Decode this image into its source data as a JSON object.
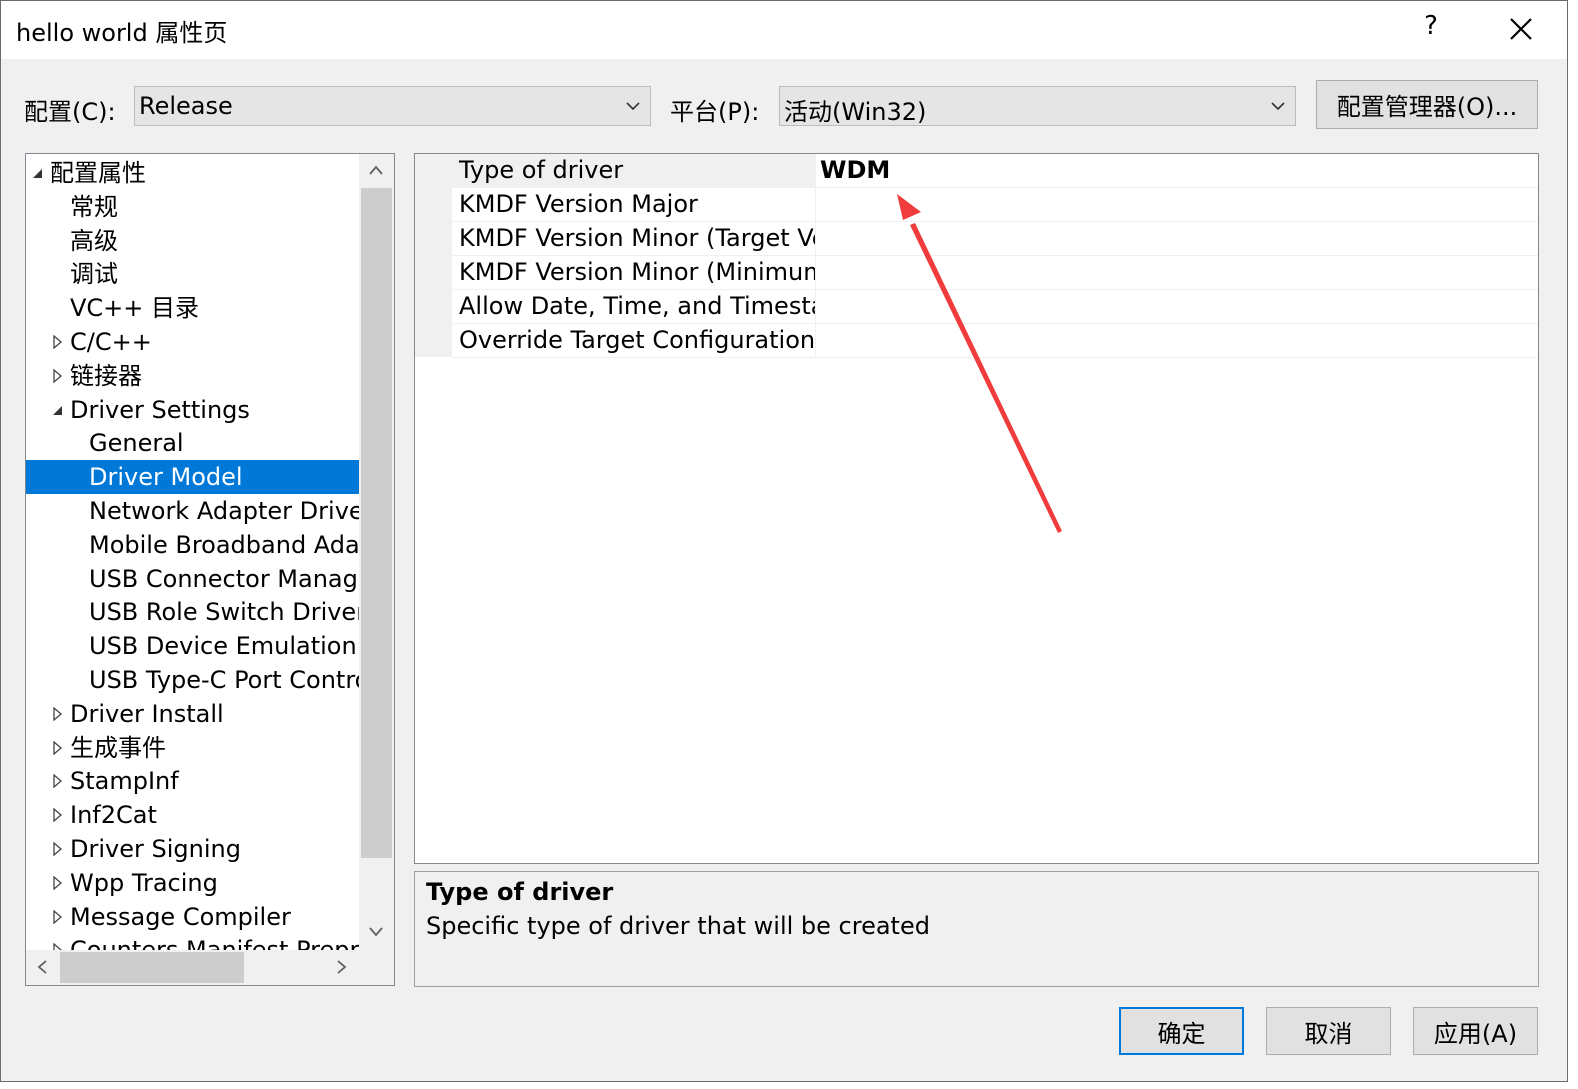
{
  "window": {
    "title": "hello world 属性页",
    "help_label": "?",
    "close_icon": "close-icon"
  },
  "config_bar": {
    "config_label": "配置(C):",
    "config_value": "Release",
    "platform_label": "平台(P):",
    "platform_value": "活动(Win32)",
    "manager_button": "配置管理器(O)..."
  },
  "tree": {
    "items": [
      {
        "label": "配置属性",
        "arrow": "expanded"
      },
      {
        "label": "常规",
        "arrow": "none"
      },
      {
        "label": "高级",
        "arrow": "none"
      },
      {
        "label": "调试",
        "arrow": "none"
      },
      {
        "label": "VC++ 目录",
        "arrow": "none"
      },
      {
        "label": "C/C++",
        "arrow": "collapsed"
      },
      {
        "label": "链接器",
        "arrow": "collapsed"
      },
      {
        "label": "Driver Settings",
        "arrow": "expanded"
      },
      {
        "label": "General",
        "arrow": "none"
      },
      {
        "label": "Driver Model",
        "arrow": "none",
        "selected": true
      },
      {
        "label": "Network Adapter Driver",
        "arrow": "none"
      },
      {
        "label": "Mobile Broadband Adapter",
        "arrow": "none"
      },
      {
        "label": "USB Connector Manager",
        "arrow": "none"
      },
      {
        "label": "USB Role Switch Driver",
        "arrow": "none"
      },
      {
        "label": "USB Device Emulation",
        "arrow": "none"
      },
      {
        "label": "USB Type-C Port Controller",
        "arrow": "none"
      },
      {
        "label": "Driver Install",
        "arrow": "collapsed"
      },
      {
        "label": "生成事件",
        "arrow": "collapsed"
      },
      {
        "label": "StampInf",
        "arrow": "collapsed"
      },
      {
        "label": "Inf2Cat",
        "arrow": "collapsed"
      },
      {
        "label": "Driver Signing",
        "arrow": "collapsed"
      },
      {
        "label": "Wpp Tracing",
        "arrow": "collapsed"
      },
      {
        "label": "Message Compiler",
        "arrow": "collapsed"
      },
      {
        "label": "Counters Manifest Preprocessor",
        "arrow": "collapsed"
      }
    ]
  },
  "properties": {
    "rows": [
      {
        "name": "Type of driver",
        "value": "WDM"
      },
      {
        "name": "KMDF Version Major",
        "value": ""
      },
      {
        "name": "KMDF Version Minor (Target Version)",
        "value": ""
      },
      {
        "name": "KMDF Version Minor (Minimum Required)",
        "value": ""
      },
      {
        "name": "Allow Date, Time, and Timestamp",
        "value": ""
      },
      {
        "name": "Override Target Configuration Properties",
        "value": ""
      }
    ]
  },
  "description": {
    "title": "Type of driver",
    "text": "Specific type of driver that will be created"
  },
  "buttons": {
    "ok": "确定",
    "cancel": "取消",
    "apply": "应用(A)"
  },
  "colors": {
    "selection": "#0078d7",
    "annotation_arrow": "#f03c3c"
  }
}
